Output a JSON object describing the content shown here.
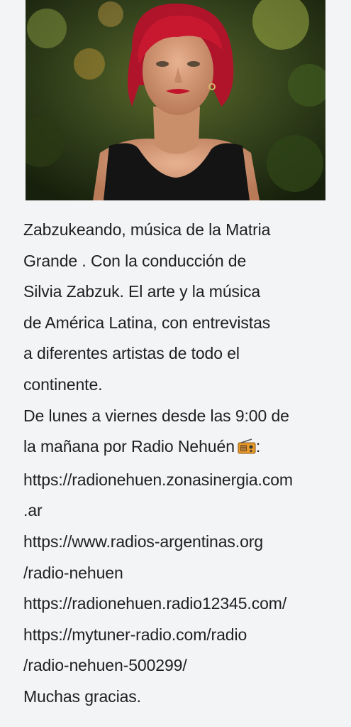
{
  "post": {
    "image": {
      "description_icon": "portrait-photo"
    },
    "lines": [
      "Zabzukeando, música de la Matria",
      "Grande . Con la conducción de",
      "Silvia Zabzuk. El arte y la música",
      "de América Latina, con entrevistas",
      "a diferentes artistas de todo el",
      "continente.",
      "De lunes a viernes desde las 9:00 de",
      "la mañana por Radio Nehuén",
      ":"
    ],
    "links": [
      "https://radionehuen.zonasinergia.com",
      ".ar",
      "https://www.radios-argentinas.org",
      "/radio-nehuen",
      "https://radionehuen.radio12345.com/",
      "https://mytuner-radio.com/radio",
      "/radio-nehuen-500299/"
    ],
    "closing": "Muchas gracias.",
    "emoji_icon": "radio-icon"
  }
}
